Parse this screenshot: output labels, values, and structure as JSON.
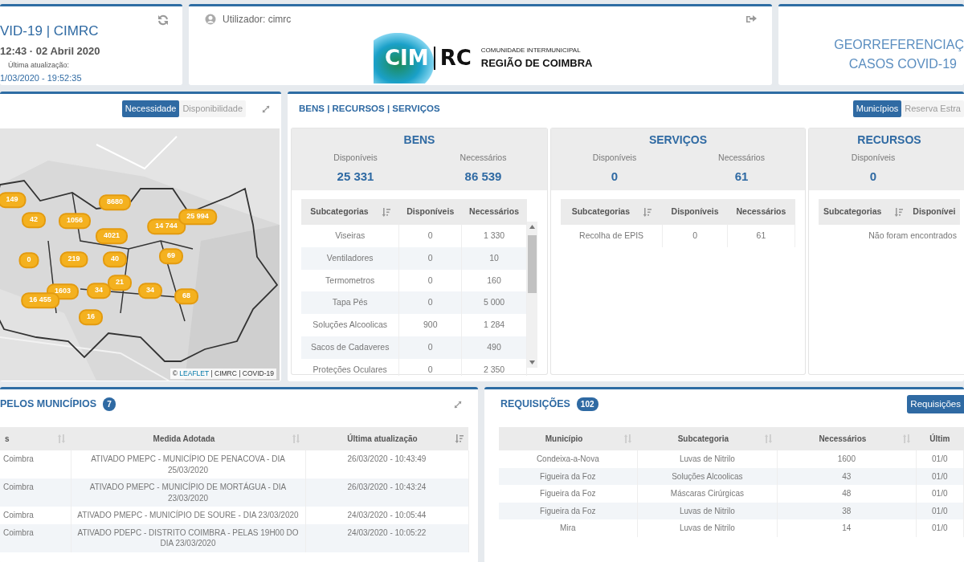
{
  "clock_card": {
    "title": "VID-19 | CIMRC",
    "datetime": "12:43 · 02 Abril 2020",
    "update_label": "Última atualização:",
    "update_value": "1/03/2020 - 19:52:35"
  },
  "user_card": {
    "user": "Utilizador: cimrc",
    "logo": {
      "mark_left": "CIM",
      "mark_right": "RC",
      "line1": "COMUNIDADE INTERMUNICIPAL",
      "line2": "REGIÃO DE COIMBRA"
    }
  },
  "title_card": {
    "line1": "GEORREFERENCIAÇ",
    "line2": "CASOS COVID-19"
  },
  "map_panel": {
    "toggles": [
      {
        "label": "Necessidade",
        "selected": true
      },
      {
        "label": "Disponibilidade",
        "selected": false
      }
    ],
    "markers": [
      {
        "label": "149"
      },
      {
        "label": "42"
      },
      {
        "label": "1056"
      },
      {
        "label": "8680"
      },
      {
        "label": "4021"
      },
      {
        "label": "14 744"
      },
      {
        "label": "25 994"
      },
      {
        "label": "0"
      },
      {
        "label": "219"
      },
      {
        "label": "40"
      },
      {
        "label": "69"
      },
      {
        "label": "1603"
      },
      {
        "label": "34"
      },
      {
        "label": "21"
      },
      {
        "label": "34"
      },
      {
        "label": "16 455"
      },
      {
        "label": "68"
      },
      {
        "label": "16"
      }
    ],
    "attribution": {
      "prefix": "©",
      "link": "LEAFLET",
      "suffix": "| CIMRC | COVID-19"
    }
  },
  "resources_panel": {
    "title": "BENS | RECURSOS | SERVIÇOS",
    "toggles": [
      {
        "label": "Municípios",
        "selected": true
      },
      {
        "label": "Reserva Estra",
        "selected": false
      }
    ],
    "groups": [
      {
        "title": "BENS",
        "stats": [
          {
            "label": "Disponíveis",
            "value": "25 331"
          },
          {
            "label": "Necessários",
            "value": "86 539"
          }
        ],
        "scrollable": true,
        "columns": [
          {
            "label": "Subcategorias",
            "sortable": true,
            "sorted": true
          },
          {
            "label": "Disponíveis",
            "sortable": false
          },
          {
            "label": "Necessários",
            "sortable": false
          }
        ],
        "rows": [
          [
            "Viseiras",
            "0",
            "1 330"
          ],
          [
            "Ventiladores",
            "0",
            "10"
          ],
          [
            "Termometros",
            "0",
            "160"
          ],
          [
            "Tapa Pés",
            "0",
            "5 000"
          ],
          [
            "Soluções Alcoolicas",
            "900",
            "1 284"
          ],
          [
            "Sacos de Cadaveres",
            "0",
            "490"
          ],
          [
            "Proteções Oculares",
            "0",
            "2 350"
          ]
        ]
      },
      {
        "title": "SERVIÇOS",
        "stats": [
          {
            "label": "Disponíveis",
            "value": "0"
          },
          {
            "label": "Necessários",
            "value": "61"
          }
        ],
        "scrollable": false,
        "columns": [
          {
            "label": "Subcategorias",
            "sortable": true,
            "sorted": true
          },
          {
            "label": "Disponíveis",
            "sortable": false
          },
          {
            "label": "Necessários",
            "sortable": false
          }
        ],
        "rows": [
          [
            "Recolha de EPIS",
            "0",
            "61"
          ]
        ]
      },
      {
        "title": "RECURSOS",
        "stats": [
          {
            "label": "Disponíveis",
            "value": "0"
          }
        ],
        "scrollable": false,
        "columns": [
          {
            "label": "Subcategorias",
            "sortable": true,
            "sorted": true
          },
          {
            "label": "Disponívei",
            "sortable": false
          }
        ],
        "empty_message": "Não foram encontrados"
      }
    ]
  },
  "measures_panel": {
    "title": "PELOS MUNICÍPIOS",
    "count": "7",
    "columns": [
      {
        "label": "s",
        "sortable": true,
        "sorted": false
      },
      {
        "label": "Medida Adotada",
        "sortable": true,
        "sorted": false
      },
      {
        "label": "Última atualização",
        "sortable": true,
        "sorted": true
      }
    ],
    "rows": [
      [
        "Coimbra",
        "ATIVADO PMEPC - MUNICÍPIO DE PENACOVA - DIA 25/03/2020",
        "26/03/2020 - 10:43:49"
      ],
      [
        "Coimbra",
        "ATIVADO PMEPC - MUNICÍPIO DE MORTÁGUA - DIA 23/03/2020",
        "26/03/2020 - 10:43:24"
      ],
      [
        "Coimbra",
        "ATIVADO PMEPC - MUNICÍPIO DE SOURE - DIA 23/03/2020",
        "24/03/2020 - 10:05:44"
      ],
      [
        "Coimbra",
        "ATIVADO PDEPC - DISTRITO COIMBRA - PELAS 19H00 DO DIA 23/03/2020",
        "24/03/2020 - 10:05:22"
      ]
    ]
  },
  "requests_panel": {
    "title": "REQUISIÇÕES",
    "count": "102",
    "button": "Requisições",
    "columns": [
      {
        "label": "Município",
        "sortable": true,
        "sorted": false
      },
      {
        "label": "Subcategoria",
        "sortable": true,
        "sorted": false
      },
      {
        "label": "Necessários",
        "sortable": true,
        "sorted": false
      },
      {
        "label": "Últim",
        "sortable": false
      }
    ],
    "rows": [
      [
        "Condeixa-a-Nova",
        "Luvas de Nitrilo",
        "1600",
        "01/0"
      ],
      [
        "Figueira da Foz",
        "Soluções Alcoolicas",
        "43",
        "01/0"
      ],
      [
        "Figueira da Foz",
        "Máscaras Cirúrgicas",
        "48",
        "01/0"
      ],
      [
        "Figueira da Foz",
        "Luvas de Nitrilo",
        "38",
        "01/0"
      ],
      [
        "Mira",
        "Luvas de Nitrilo",
        "14",
        "01/0"
      ]
    ]
  }
}
